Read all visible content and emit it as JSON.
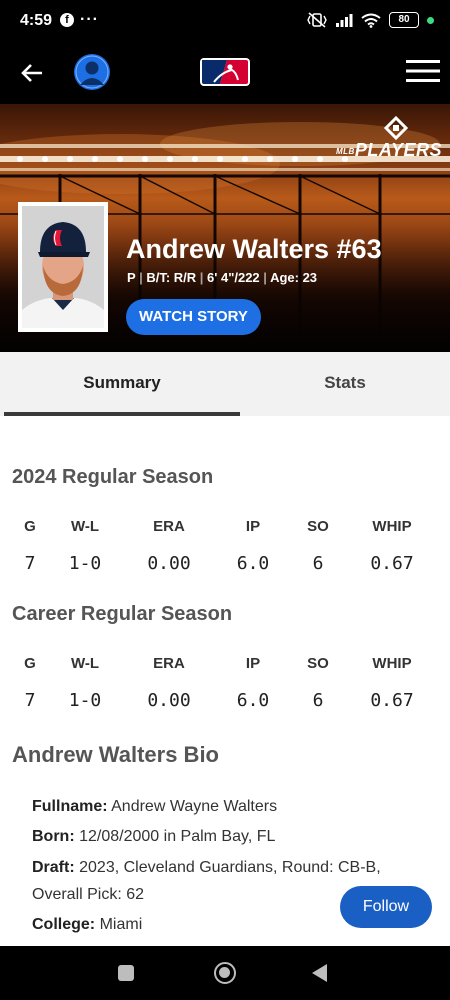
{
  "status_bar": {
    "time": "4:59",
    "more_indicator": "···",
    "battery": "80"
  },
  "header": {
    "back_icon": "arrow-left-icon",
    "profile_icon": "user-avatar-icon",
    "logo": "MLB",
    "menu_icon": "hamburger-menu-icon"
  },
  "player": {
    "name": "Andrew Walters #63",
    "position": "P",
    "bats_throws": "B/T: R/R",
    "height_weight": "6' 4\"/222",
    "age": "Age: 23",
    "watch_story_label": "WATCH STORY",
    "badge_text": "PLAYERS",
    "badge_prefix": "MLB"
  },
  "tabs": [
    {
      "label": "Summary",
      "active": true
    },
    {
      "label": "Stats",
      "active": false
    }
  ],
  "stats_columns": [
    "G",
    "W-L",
    "ERA",
    "IP",
    "SO",
    "WHIP"
  ],
  "season_2024": {
    "title": "2024 Regular Season",
    "values": [
      "7",
      "1-0",
      "0.00",
      "6.0",
      "6",
      "0.67"
    ]
  },
  "career": {
    "title": "Career Regular Season",
    "values": [
      "7",
      "1-0",
      "0.00",
      "6.0",
      "6",
      "0.67"
    ]
  },
  "bio": {
    "title": "Andrew Walters Bio",
    "fullname_label": "Fullname:",
    "fullname": "Andrew Wayne Walters",
    "born_label": "Born:",
    "born": "12/08/2000 in Palm Bay, FL",
    "draft_label": "Draft:",
    "draft_line1": "2023, Cleveland Guardians, Round: CB-B,",
    "draft_line2": "Overall Pick: 62",
    "college_label": "College:",
    "college": "Miami"
  },
  "follow_label": "Follow",
  "colors": {
    "accent_blue": "#1d6fe3",
    "follow_blue": "#1a5fc4",
    "tab_bg": "#f2f2f2"
  }
}
